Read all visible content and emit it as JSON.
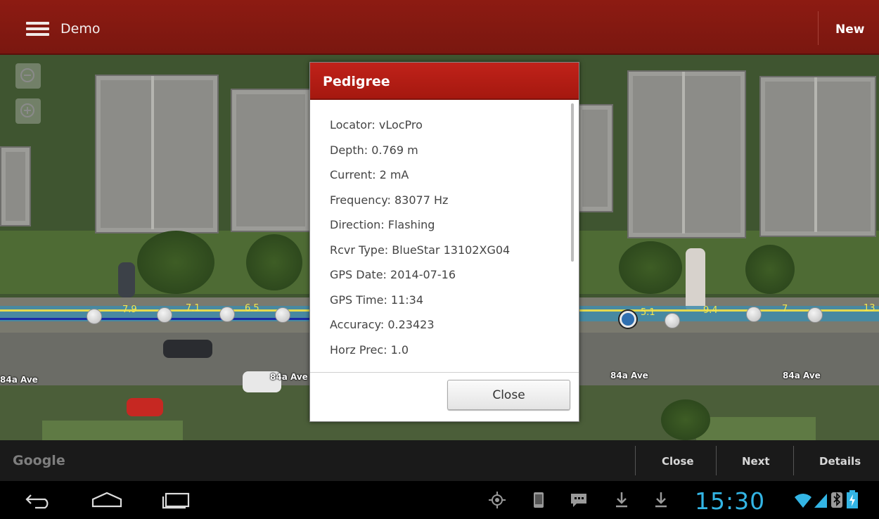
{
  "app": {
    "title": "Demo",
    "new_label": "New"
  },
  "map": {
    "street_labels": [
      "84a Ave",
      "84a Ave",
      "84a Ave",
      "84a Ave"
    ],
    "segment_labels": [
      "7.9",
      "7.1",
      "6.5",
      "5.1",
      "9.4",
      "7",
      "13"
    ],
    "google_logo": "Google"
  },
  "dialog": {
    "title": "Pedigree",
    "fields": [
      "Locator: vLocPro",
      "Depth: 0.769 m",
      "Current: 2 mA",
      "Frequency: 83077 Hz",
      "Direction: Flashing",
      "Rcvr Type: BlueStar 13102XG04",
      "GPS Date: 2014-07-16",
      "GPS Time: 11:34",
      "Accuracy: 0.23423",
      "Horz Prec: 1.0"
    ],
    "close_label": "Close"
  },
  "actionbar": {
    "close_label": "Close",
    "next_label": "Next",
    "details_label": "Details"
  },
  "statusbar": {
    "time": "15:30"
  },
  "colors": {
    "header": "#8d1b12",
    "dialog_header": "#b51d15",
    "clock": "#33b5e5",
    "route": "#408caa",
    "route_line": "#e5d94e"
  }
}
